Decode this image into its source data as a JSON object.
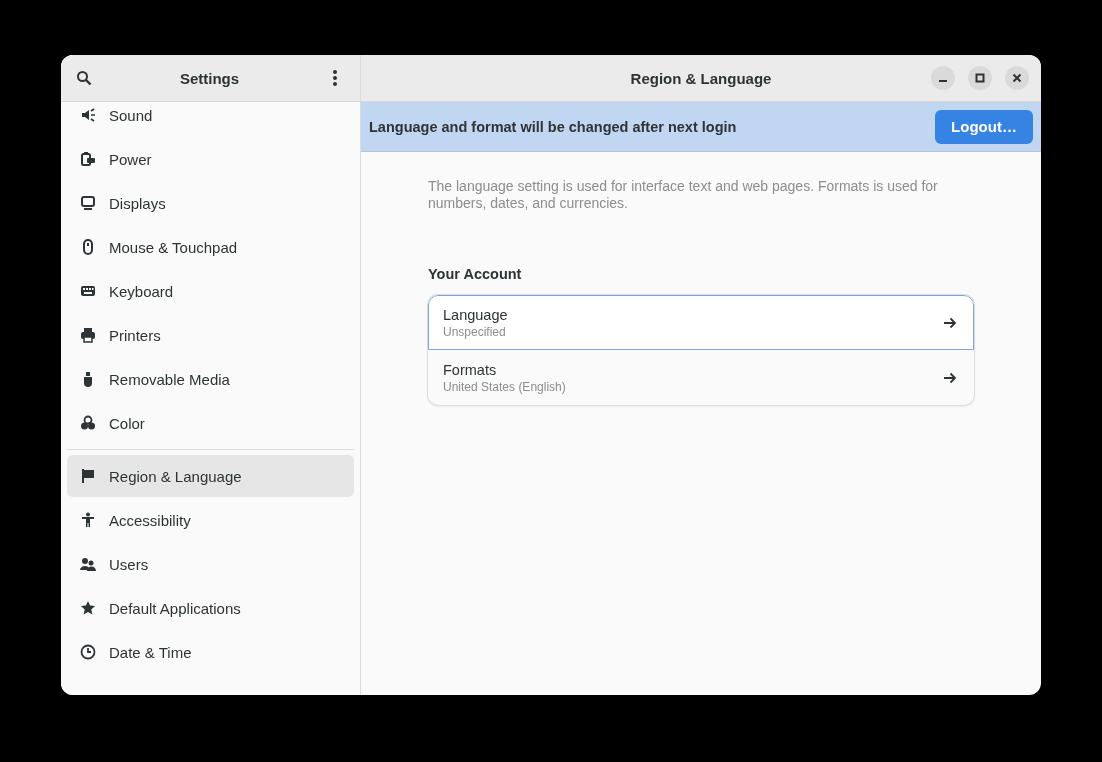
{
  "sidebar": {
    "title": "Settings",
    "items": [
      {
        "label": "Sound",
        "selected": false
      },
      {
        "label": "Power",
        "selected": false
      },
      {
        "label": "Displays",
        "selected": false
      },
      {
        "label": "Mouse & Touchpad",
        "selected": false
      },
      {
        "label": "Keyboard",
        "selected": false
      },
      {
        "label": "Printers",
        "selected": false
      },
      {
        "label": "Removable Media",
        "selected": false
      },
      {
        "label": "Color",
        "selected": false
      },
      {
        "label": "Region & Language",
        "selected": true
      },
      {
        "label": "Accessibility",
        "selected": false
      },
      {
        "label": "Users",
        "selected": false
      },
      {
        "label": "Default Applications",
        "selected": false
      },
      {
        "label": "Date & Time",
        "selected": false
      }
    ]
  },
  "window": {
    "title": "Region & Language"
  },
  "banner": {
    "message": "Language and format will be changed after next login",
    "button": "Logout…"
  },
  "description": "The language setting is used for interface text and web pages. Formats is used for numbers, dates, and currencies.",
  "section": {
    "title": "Your Account",
    "rows": [
      {
        "title": "Language",
        "subtitle": "Unspecified",
        "selected": true
      },
      {
        "title": "Formats",
        "subtitle": "United States (English)",
        "selected": false
      }
    ]
  }
}
